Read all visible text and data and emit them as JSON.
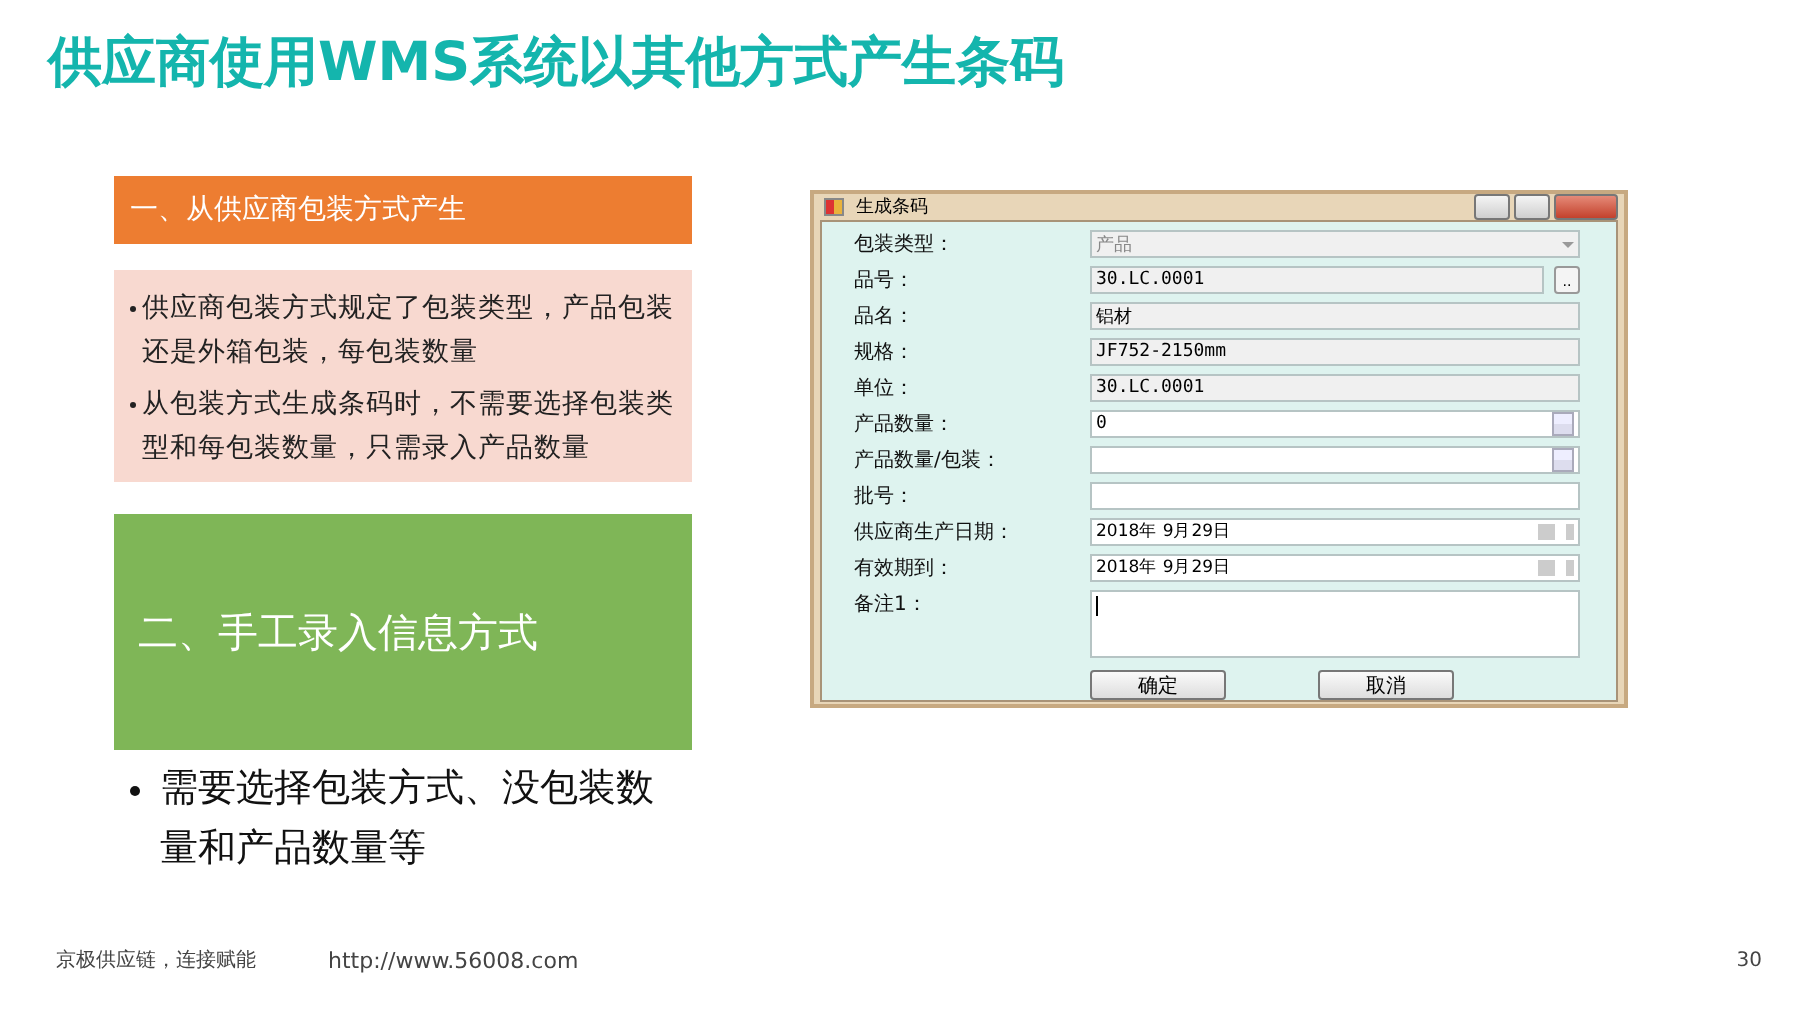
{
  "title": "供应商使用WMS系统以其他方式产生条码",
  "section_one": {
    "heading": "一、从供应商包装方式产生",
    "bullets": [
      "供应商包装方式规定了包装类型，产品包装还是外箱包装，每包装数量",
      "从包装方式生成条码时，不需要选择包装类型和每包装数量，只需录入产品数量"
    ]
  },
  "section_two": {
    "heading": "二、手工录入信息方式",
    "bullets": [
      "需要选择包装方式、没包装数量和产品数量等"
    ]
  },
  "window": {
    "title": "生成条码",
    "fields": [
      {
        "kind": "combo",
        "label": "包装类型：",
        "value": "产品",
        "disabled": true
      },
      {
        "kind": "lookup",
        "label": "品号：",
        "value": "30.LC.0001",
        "button": ".."
      },
      {
        "kind": "readonly",
        "label": "品名：",
        "value": "铝材"
      },
      {
        "kind": "readonly",
        "label": "规格：",
        "value": "JF752-2150mm"
      },
      {
        "kind": "readonly",
        "label": "单位：",
        "value": "30.LC.0001"
      },
      {
        "kind": "spin",
        "label": "产品数量：",
        "value": "0"
      },
      {
        "kind": "spin",
        "label": "产品数量/包装："
      },
      {
        "kind": "text",
        "label": "批号："
      },
      {
        "kind": "date",
        "label": "供应商生产日期：",
        "value": "2018年  9月29日"
      },
      {
        "kind": "date",
        "label": "有效期到：",
        "value": "2018年  9月29日"
      },
      {
        "kind": "memo",
        "label": "备注1："
      }
    ],
    "buttons": [
      "确定",
      "取消"
    ]
  },
  "footer": {
    "slogan": "京极供应链，连接赋能",
    "url": "http://www.56008.com",
    "page_number": "30"
  }
}
